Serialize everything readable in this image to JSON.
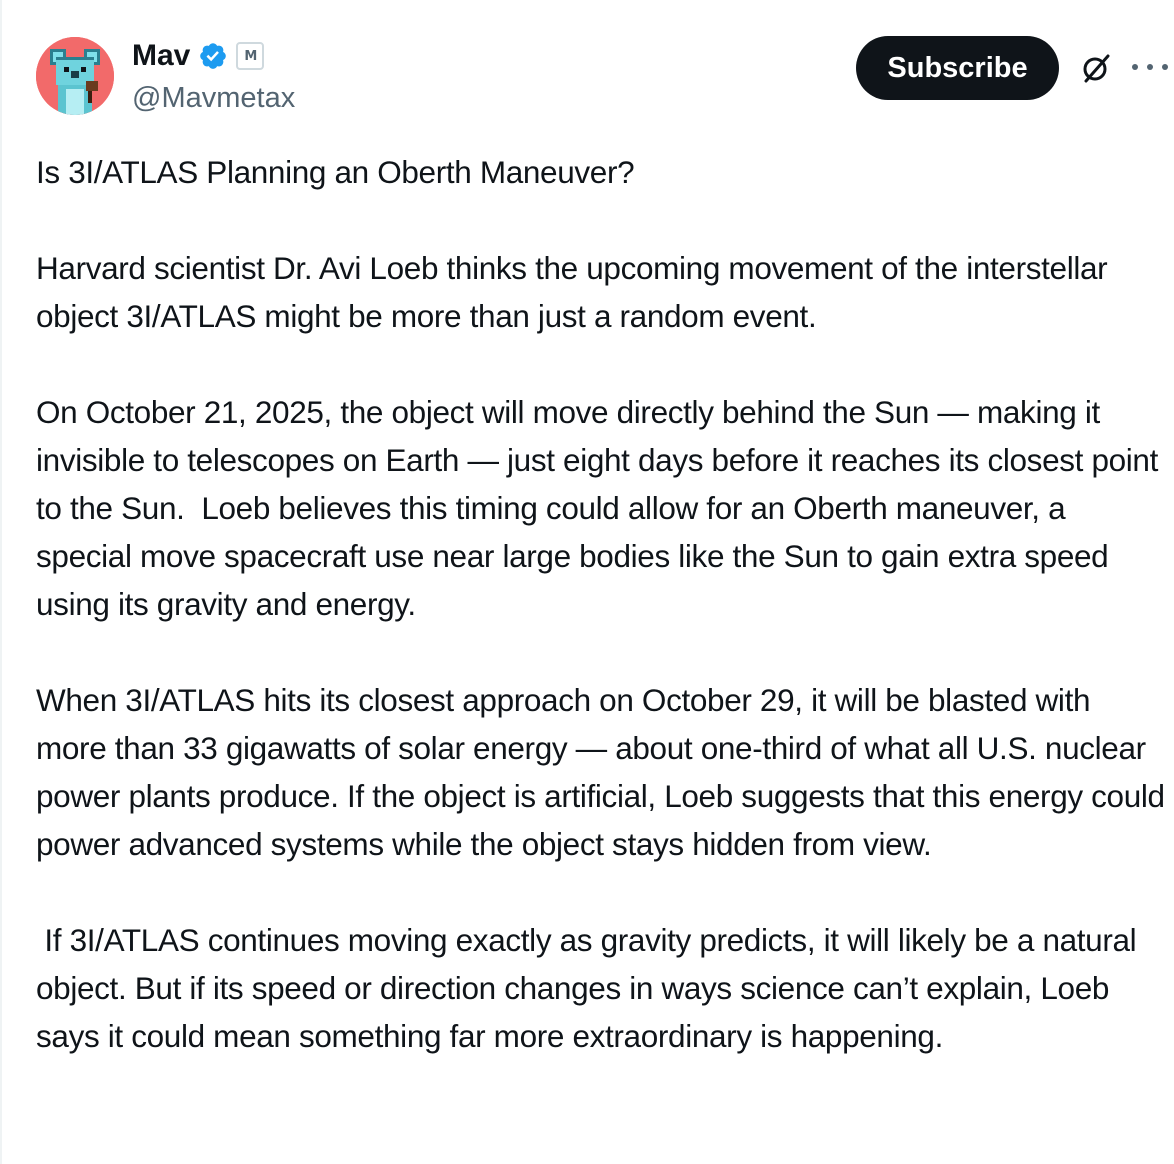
{
  "author": {
    "display_name": "Mav",
    "handle": "@Mavmetax",
    "avatar_icon": "pixel-koala-avatar",
    "verified_icon": "verified-badge-icon",
    "affiliate_badge_text": "M",
    "avatar_bg": "#f26a6a",
    "verified_color": "#1d9bf0"
  },
  "actions": {
    "subscribe_label": "Subscribe",
    "grok_icon": "grok-slash-circle-icon",
    "more_icon": "more-options-icon"
  },
  "post": {
    "paragraphs": [
      "Is 3I/ATLAS Planning an Oberth Maneuver?",
      "Harvard scientist Dr. Avi Loeb thinks the upcoming movement of the interstellar object 3I/ATLAS might be more than just a random event.",
      "On October 21, 2025, the object will move directly behind the Sun — making it invisible to telescopes on Earth — just eight days before it reaches its closest point to the Sun.  Loeb believes this timing could allow for an Oberth maneuver, a special move spacecraft use near large bodies like the Sun to gain extra speed using its gravity and energy.",
      "When 3I/ATLAS hits its closest approach on October 29, it will be blasted with more than 33 gigawatts of solar energy — about one-third of what all U.S. nuclear power plants produce. If the object is artificial, Loeb suggests that this energy could power advanced systems while the object stays hidden from view.",
      " If 3I/ATLAS continues moving exactly as gravity predicts, it will likely be a natural object. But if its speed or direction changes in ways science can’t explain, Loeb says it could mean something far more extraordinary is happening."
    ]
  }
}
